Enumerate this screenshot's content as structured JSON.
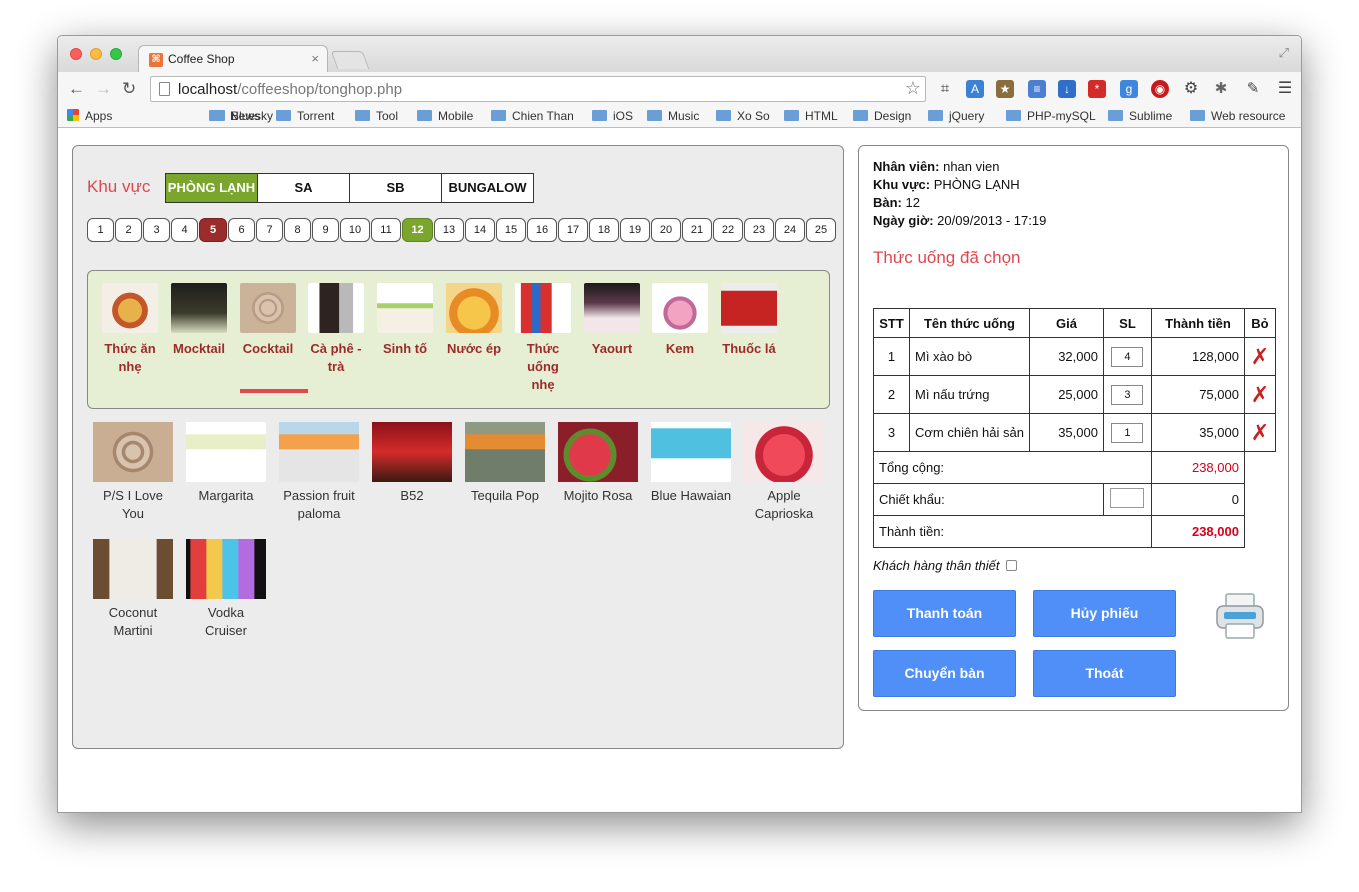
{
  "browser": {
    "tab_title": "Coffee Shop",
    "tab_close": "×",
    "url_host": "localhost",
    "url_path": "/coffeeshop/tonghop.php",
    "bookmarks": [
      "Apps",
      "Bluesky",
      "News",
      "Torrent",
      "Tool",
      "Mobile",
      "Chien Than",
      "iOS",
      "Music",
      "Xo So",
      "HTML",
      "Design",
      "jQuery",
      "PHP-mySQL",
      "Sublime",
      "Web resource"
    ]
  },
  "left": {
    "area_label": "Khu vực",
    "areas": [
      "PHÒNG LẠNH",
      "SA",
      "SB",
      "BUNGALOW"
    ],
    "active_area": "PHÒNG LẠNH",
    "tables": [
      "1",
      "2",
      "3",
      "4",
      "5",
      "6",
      "7",
      "8",
      "9",
      "10",
      "11",
      "12",
      "13",
      "14",
      "15",
      "16",
      "17",
      "18",
      "19",
      "20",
      "21",
      "22",
      "23",
      "24",
      "25"
    ],
    "busy_table": "5",
    "selected_table": "12",
    "categories": [
      {
        "l1": "Thức ăn",
        "l2": "nhẹ",
        "l3": ""
      },
      {
        "l1": "Mocktail",
        "l2": "",
        "l3": ""
      },
      {
        "l1": "Cocktail",
        "l2": "",
        "l3": ""
      },
      {
        "l1": "Cà phê -",
        "l2": "trà",
        "l3": ""
      },
      {
        "l1": "Sinh tố",
        "l2": "",
        "l3": ""
      },
      {
        "l1": "Nước ép",
        "l2": "",
        "l3": ""
      },
      {
        "l1": "Thức",
        "l2": "uống",
        "l3": "nhẹ"
      },
      {
        "l1": "Yaourt",
        "l2": "",
        "l3": ""
      },
      {
        "l1": "Kem",
        "l2": "",
        "l3": ""
      },
      {
        "l1": "Thuốc lá",
        "l2": "",
        "l3": ""
      }
    ],
    "active_category": "Cocktail",
    "products": [
      {
        "l1": "P/S I Love",
        "l2": "You"
      },
      {
        "l1": "Margarita",
        "l2": ""
      },
      {
        "l1": "Passion fruit",
        "l2": "paloma"
      },
      {
        "l1": "B52",
        "l2": ""
      },
      {
        "l1": "Tequila Pop",
        "l2": ""
      },
      {
        "l1": "Mojito Rosa",
        "l2": ""
      },
      {
        "l1": "Blue Hawaian",
        "l2": ""
      },
      {
        "l1": "Apple",
        "l2": "Caprioska"
      },
      {
        "l1": "Coconut",
        "l2": "Martini"
      },
      {
        "l1": "Vodka",
        "l2": "Cruiser"
      }
    ]
  },
  "right": {
    "staff_label": "Nhân viên:",
    "staff": "nhan vien",
    "area_label": "Khu vực:",
    "area": "PHÒNG LẠNH",
    "table_label": "Bàn:",
    "table": "12",
    "datetime_label": "Ngày giờ:",
    "datetime": "20/09/2013 - 17:19",
    "section_title": "Thức uống đã chọn",
    "columns": [
      "STT",
      "Tên thức uống",
      "Giá",
      "SL",
      "Thành tiền",
      "Bỏ"
    ],
    "rows": [
      {
        "stt": "1",
        "name": "Mì xào bò",
        "price": "32,000",
        "qty": "4",
        "total": "128,000"
      },
      {
        "stt": "2",
        "name": "Mì nấu trứng",
        "price": "25,000",
        "qty": "3",
        "total": "75,000"
      },
      {
        "stt": "3",
        "name": "Cơm chiên hải sản",
        "price": "35,000",
        "qty": "1",
        "total": "35,000"
      }
    ],
    "subtotal_label": "Tổng cộng:",
    "subtotal": "238,000",
    "discount_label": "Chiết khẩu:",
    "discount": "0",
    "grand_label": "Thành tiền:",
    "grand": "238,000",
    "loyal_label": "Khách hàng thân thiết",
    "buttons": {
      "pay": "Thanh toán",
      "cancel": "Hủy phiếu",
      "move": "Chuyển bàn",
      "exit": "Thoát"
    }
  },
  "colors": {
    "accent_red": "#e0474f",
    "active_green": "#7aa62d",
    "busy_red": "#9b2c2c",
    "button_blue": "#4f8ff7"
  }
}
